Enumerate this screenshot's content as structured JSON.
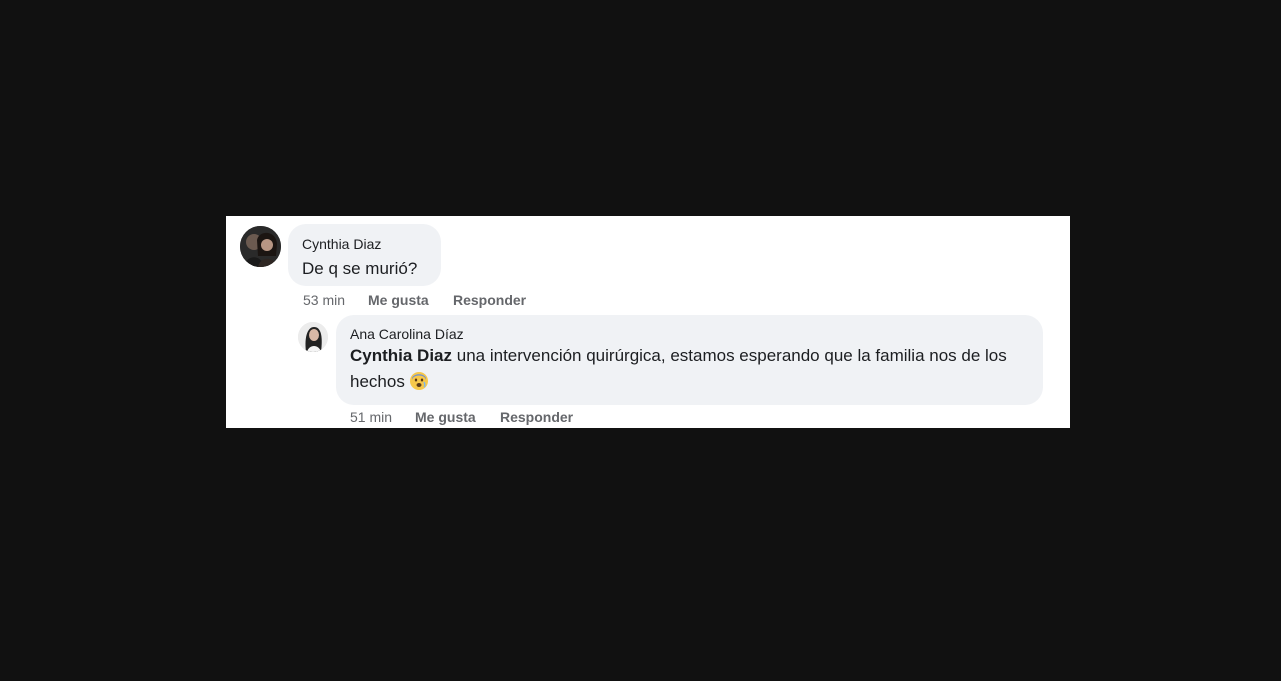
{
  "comments": [
    {
      "author": "Cynthia Diaz",
      "text": "De q se murió?",
      "time": "53 min",
      "like_label": "Me gusta",
      "reply_label": "Responder"
    },
    {
      "author": "Ana Carolina Díaz",
      "mention": "Cynthia Diaz",
      "text": " una intervención quirúrgica, estamos esperando que la familia nos de los hechos",
      "emoji": "anxious-face-icon",
      "time": "51 min",
      "like_label": "Me gusta",
      "reply_label": "Responder"
    }
  ],
  "colors": {
    "page_background": "#111111",
    "panel_background": "#ffffff",
    "bubble_background": "#f0f2f5",
    "text": "#1c1e21",
    "meta_text": "#65676b"
  }
}
